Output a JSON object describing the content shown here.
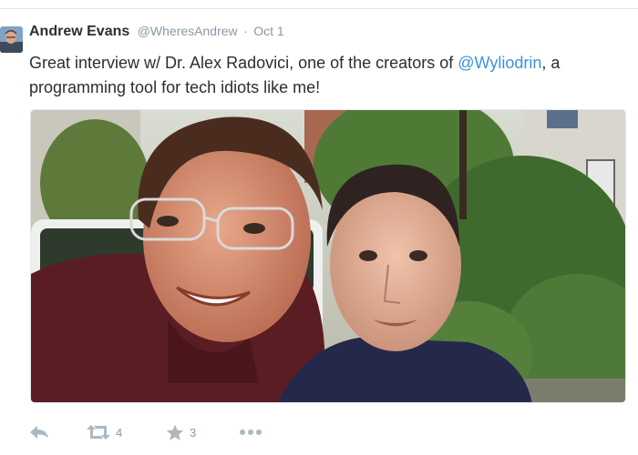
{
  "tweet": {
    "author": {
      "name": "Andrew Evans",
      "handle": "@WheresAndrew"
    },
    "separator": "·",
    "timestamp": "Oct 1",
    "text": {
      "part1": "Great interview w/ Dr. Alex Radovici, one of the creators of ",
      "mention": "@Wyliodrin",
      "part2": ", a programming tool for tech idiots like me!"
    },
    "photo": {
      "description_icon": "selfie-photo"
    },
    "actions": {
      "reply_icon": "reply-icon",
      "retweet_icon": "retweet-icon",
      "retweet_count": "4",
      "favorite_icon": "star-icon",
      "favorite_count": "3",
      "more_icon": "more-icon"
    }
  },
  "colors": {
    "link": "#3b94d9",
    "muted": "#8899a6",
    "icon": "#aab8c2",
    "text": "#292f33"
  }
}
